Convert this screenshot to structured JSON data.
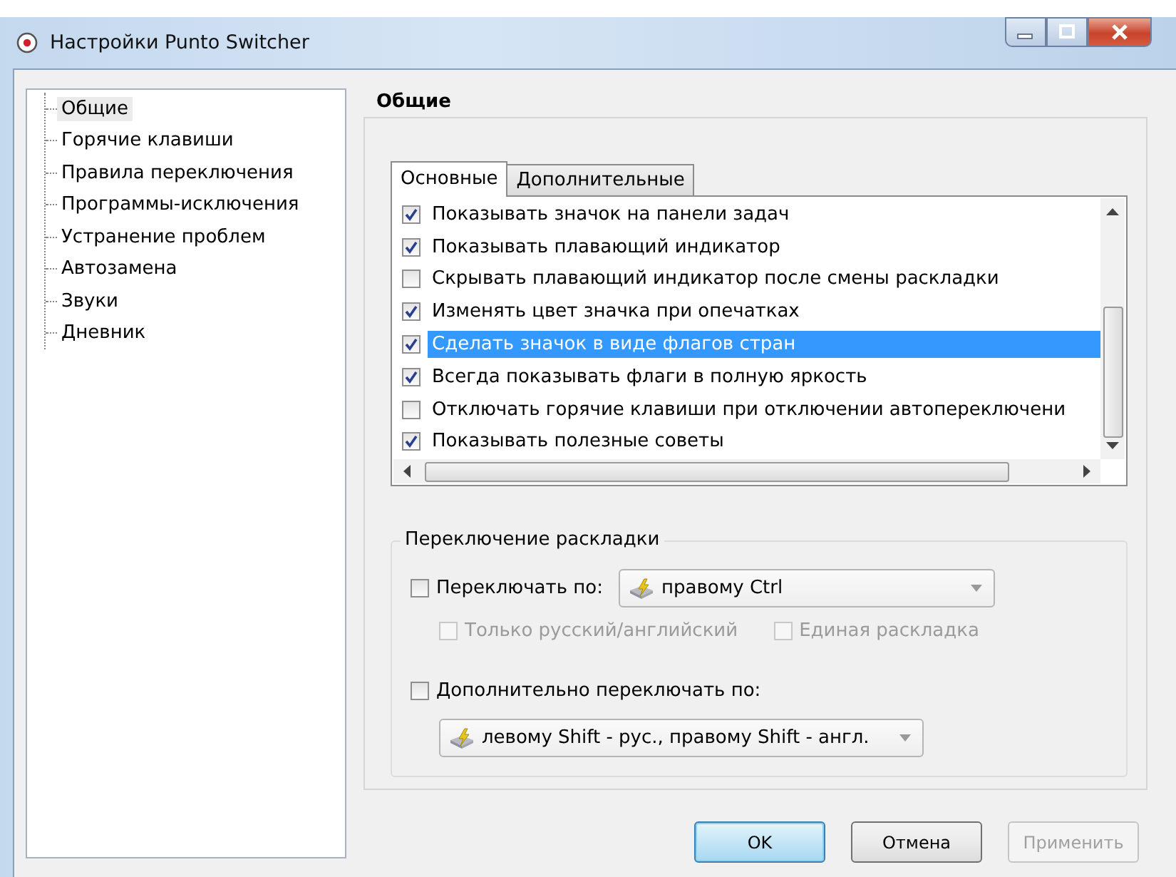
{
  "window": {
    "title": "Настройки Punto Switcher"
  },
  "sidebar": {
    "items": [
      {
        "label": "Общие",
        "selected": true
      },
      {
        "label": "Горячие клавиши",
        "selected": false
      },
      {
        "label": "Правила переключения",
        "selected": false
      },
      {
        "label": "Программы-исключения",
        "selected": false
      },
      {
        "label": "Устранение проблем",
        "selected": false
      },
      {
        "label": "Автозамена",
        "selected": false
      },
      {
        "label": "Звуки",
        "selected": false
      },
      {
        "label": "Дневник",
        "selected": false
      }
    ]
  },
  "section_title": "Общие",
  "tabs": [
    {
      "label": "Основные",
      "selected": true
    },
    {
      "label": "Дополнительные",
      "selected": false
    }
  ],
  "options": [
    {
      "label": "Показывать значок на панели задач",
      "checked": true,
      "selected": false
    },
    {
      "label": "Показывать плавающий индикатор",
      "checked": true,
      "selected": false
    },
    {
      "label": "Скрывать плавающий индикатор после смены раскладки",
      "checked": false,
      "selected": false
    },
    {
      "label": "Изменять цвет значка при опечатках",
      "checked": true,
      "selected": false
    },
    {
      "label": "Сделать значок в виде флагов стран",
      "checked": true,
      "selected": true
    },
    {
      "label": "Всегда показывать флаги в полную яркость",
      "checked": true,
      "selected": false
    },
    {
      "label": "Отключать горячие клавиши при отключении автопереключени",
      "checked": false,
      "selected": false
    },
    {
      "label": "Показывать полезные советы",
      "checked": true,
      "selected": false
    }
  ],
  "layout_switch": {
    "title": "Переключение раскладки",
    "switch_by": {
      "label": "Переключать по:",
      "checked": false,
      "value": "правому Ctrl"
    },
    "sub_options": [
      {
        "label": "Только русский/английский",
        "checked": false,
        "disabled": true
      },
      {
        "label": "Единая раскладка",
        "checked": false,
        "disabled": true
      }
    ],
    "extra_switch": {
      "label": "Дополнительно переключать по:",
      "checked": false,
      "value": "левому Shift - рус., правому Shift - англ."
    }
  },
  "buttons": [
    {
      "label": "OK",
      "kind": "default",
      "disabled": false
    },
    {
      "label": "Отмена",
      "kind": "normal",
      "disabled": false
    },
    {
      "label": "Применить",
      "kind": "normal",
      "disabled": true
    }
  ]
}
